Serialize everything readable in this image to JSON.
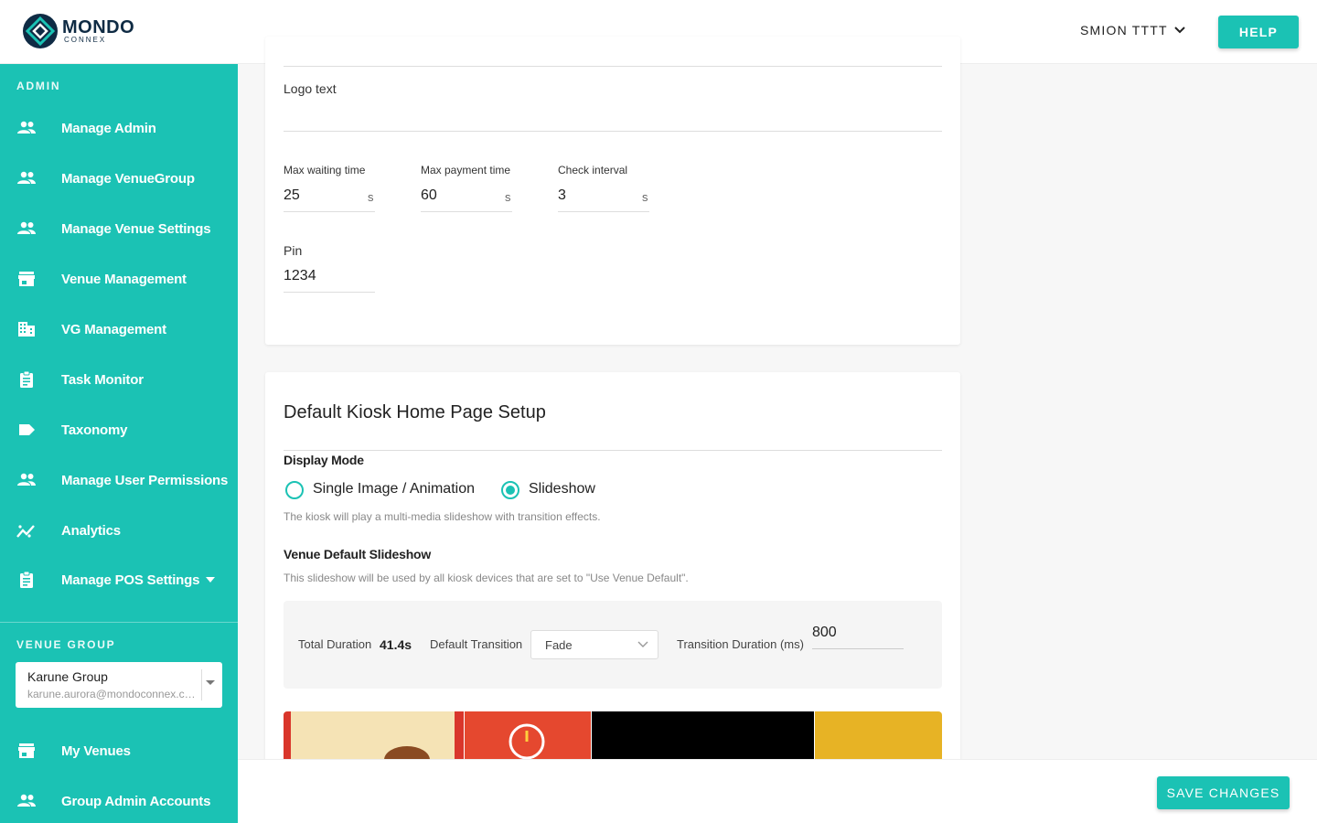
{
  "header": {
    "logo_name": "MONDO",
    "logo_sub": "CONNEX",
    "user_name": "SMION TTTT",
    "help_label": "HELP"
  },
  "sidebar": {
    "admin_label": "ADMIN",
    "items": [
      {
        "label": "Manage Admin",
        "icon": "people-icon"
      },
      {
        "label": "Manage VenueGroup",
        "icon": "people-icon"
      },
      {
        "label": "Manage Venue Settings",
        "icon": "people-icon"
      },
      {
        "label": "Venue Management",
        "icon": "store-icon"
      },
      {
        "label": "VG Management",
        "icon": "building-icon"
      },
      {
        "label": "Task Monitor",
        "icon": "clipboard-icon"
      },
      {
        "label": "Taxonomy",
        "icon": "tag-icon"
      },
      {
        "label": "Manage User Permissions",
        "icon": "people-icon"
      },
      {
        "label": "Analytics",
        "icon": "analytics-icon"
      },
      {
        "label": "Manage POS Settings",
        "icon": "clipboard-icon"
      }
    ],
    "venue_group_label": "VENUE GROUP",
    "venue_group": {
      "name": "Karune Group",
      "email": "karune.aurora@mondoconnex.com"
    },
    "bottom_items": [
      {
        "label": "My Venues",
        "icon": "store-icon"
      },
      {
        "label": "Group Admin Accounts",
        "icon": "people-icon"
      }
    ]
  },
  "settings": {
    "logo_text_label": "Logo text",
    "logo_text_value": "",
    "max_waiting_label": "Max waiting time",
    "max_waiting_value": "25",
    "max_payment_label": "Max payment time",
    "max_payment_value": "60",
    "check_interval_label": "Check interval",
    "check_interval_value": "3",
    "unit": "s",
    "pin_label": "Pin",
    "pin_value": "1234"
  },
  "kiosk": {
    "title": "Default Kiosk Home Page Setup",
    "display_mode_label": "Display Mode",
    "option_single": "Single Image / Animation",
    "option_slideshow": "Slideshow",
    "selected_option": "Slideshow",
    "slideshow_helper": "The kiosk will play a multi-media slideshow with transition effects.",
    "venue_slideshow_label": "Venue Default Slideshow",
    "venue_slideshow_helper": "This slideshow will be used by all kiosk devices that are set to \"Use Venue Default\".",
    "total_duration_label": "Total Duration",
    "total_duration_value": "41.4s",
    "default_transition_label": "Default Transition",
    "default_transition_value": "Fade",
    "transition_duration_label": "Transition Duration (ms)",
    "transition_duration_value": "800"
  },
  "footer": {
    "save_label": "SAVE CHANGES"
  },
  "colors": {
    "accent": "#1bc2b4",
    "logo_dark": "#0f2b44"
  }
}
